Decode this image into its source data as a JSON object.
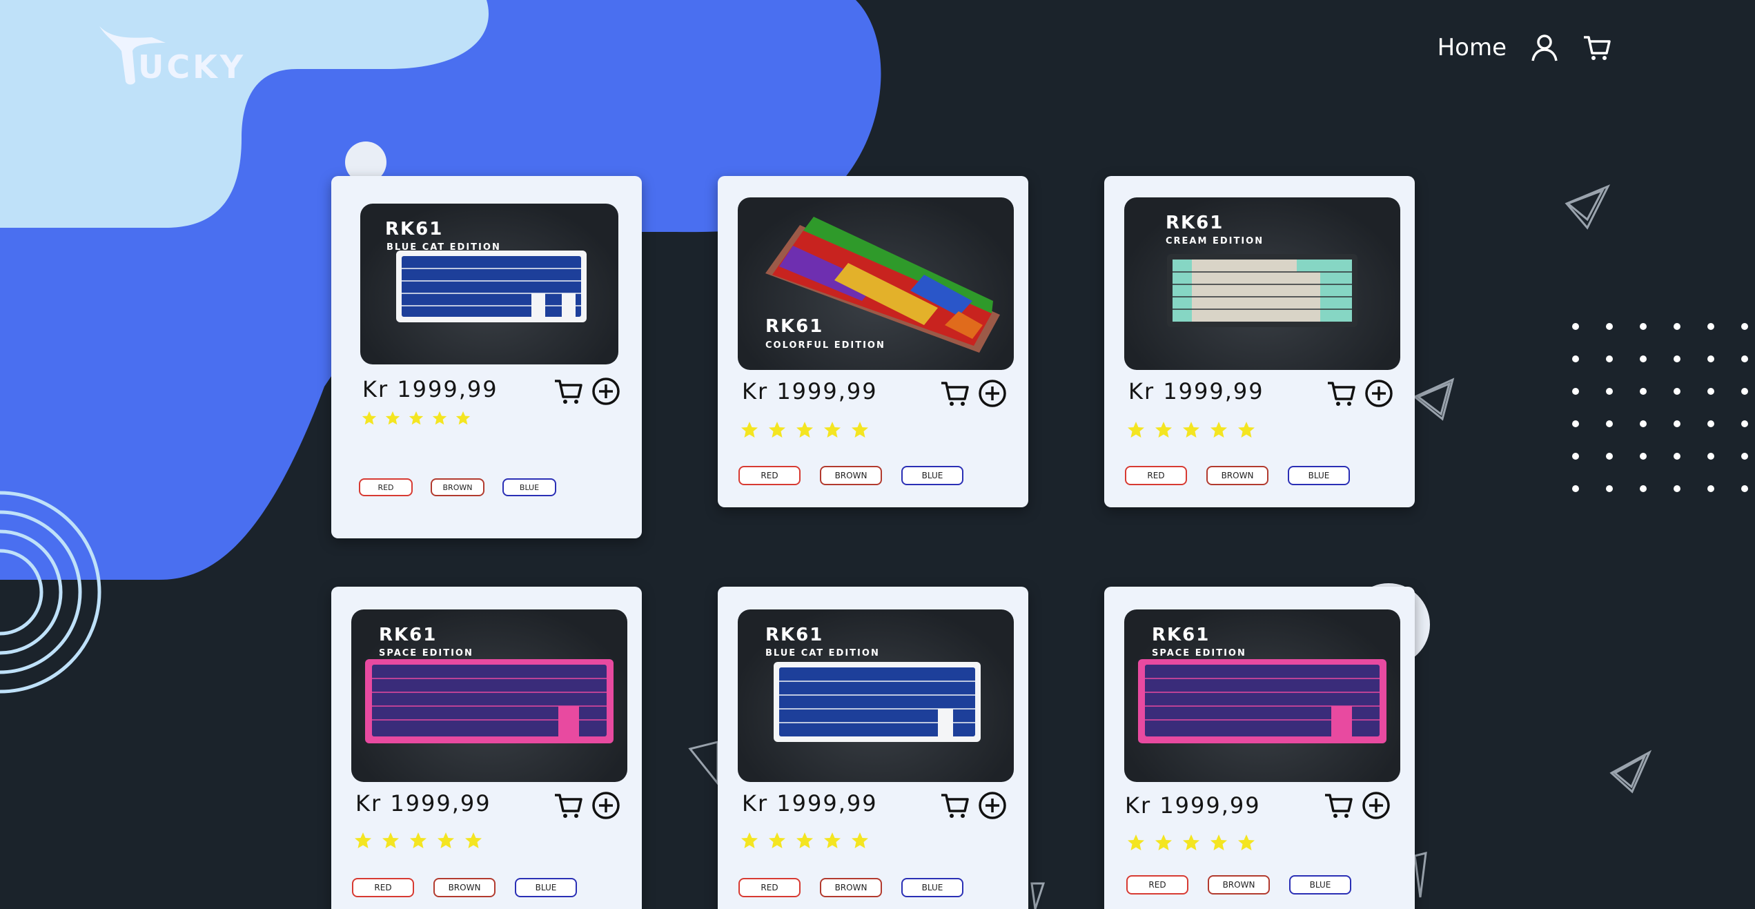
{
  "brand": {
    "logo_text": "UCKY"
  },
  "nav": {
    "home_label": "Home"
  },
  "products": [
    {
      "model": "RK61",
      "edition": "Blue Cat Edition",
      "price": "Kr 1999,99",
      "rating": 5,
      "variants": [
        "RED",
        "BROWN",
        "BLUE"
      ]
    },
    {
      "model": "RK61",
      "edition": "Colorful Edition",
      "price": "Kr 1999,99",
      "rating": 5,
      "variants": [
        "RED",
        "BROWN",
        "BLUE"
      ]
    },
    {
      "model": "RK61",
      "edition": "Cream Edition",
      "price": "Kr 1999,99",
      "rating": 5,
      "variants": [
        "RED",
        "BROWN",
        "BLUE"
      ]
    },
    {
      "model": "RK61",
      "edition": "Space Edition",
      "price": "Kr 1999,99",
      "rating": 5,
      "variants": [
        "RED",
        "BROWN",
        "BLUE"
      ]
    },
    {
      "model": "RK61",
      "edition": "Blue Cat Edition",
      "price": "Kr 1999,99",
      "rating": 5,
      "variants": [
        "RED",
        "BROWN",
        "BLUE"
      ]
    },
    {
      "model": "RK61",
      "edition": "Space Edition",
      "price": "Kr 1999,99",
      "rating": 5,
      "variants": [
        "RED",
        "BROWN",
        "BLUE"
      ]
    }
  ],
  "colors": {
    "background": "#1b232b",
    "blob_blue": "#4a6ff0",
    "blob_light": "#bfe1f9",
    "card": "#eef3fb",
    "star": "#f4e521",
    "variant_red": "#d73a32",
    "variant_brown": "#b23a2e",
    "variant_blue": "#2a2fb5"
  },
  "icons": [
    "user-icon",
    "cart-icon",
    "add-circle-icon",
    "star-icon"
  ]
}
